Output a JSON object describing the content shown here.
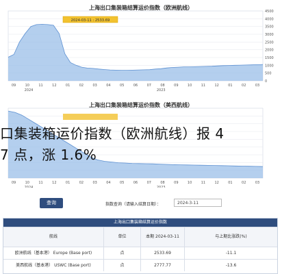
{
  "chart_data": [
    {
      "type": "area",
      "title": "上海出口集装箱结算运价指数（欧洲航线）",
      "tooltip": "2024-03-11 : 2533.69",
      "ylim": [
        0,
        4500
      ],
      "yticks": [
        "4500",
        "4000",
        "3500",
        "3000",
        "2500",
        "2000",
        "1500",
        "1000",
        "500",
        "0"
      ],
      "xticks": [
        "09",
        "10",
        "11",
        "12",
        "01",
        "02",
        "03",
        "04",
        "05",
        "06",
        "07",
        "08",
        "09",
        "10",
        "11",
        "12",
        "01",
        "02",
        "03"
      ],
      "year_labels": [
        "2024",
        "2023"
      ],
      "color": "#9bbfe8",
      "series": [
        {
          "values": [
            1520,
            1700,
            2500,
            3050,
            3500,
            3620,
            3640,
            3620,
            3580,
            3050,
            1750,
            1180,
            1000,
            880,
            820,
            800,
            760,
            730,
            700,
            690,
            680,
            680,
            690,
            700,
            710,
            720,
            760,
            780,
            830,
            860,
            880,
            900,
            900,
            910,
            920,
            930,
            940,
            960,
            980,
            990,
            1000,
            1010,
            1020,
            1030,
            1040,
            1050
          ]
        }
      ]
    },
    {
      "type": "area",
      "title": "上海出口集装箱结算运价指数（美西航线）",
      "color": "#9bbfe8",
      "series": [
        {
          "values": [
            4800,
            4700,
            4500,
            4200,
            3900,
            3600,
            3300,
            3000,
            2700,
            2400,
            2100,
            1800,
            1500,
            1300,
            1200,
            1150,
            1100,
            1080,
            1050,
            1040,
            1030,
            1020,
            1000,
            980,
            960,
            950,
            940,
            930,
            920,
            910,
            900,
            890,
            880,
            870,
            860,
            850,
            840,
            830
          ]
        }
      ]
    }
  ],
  "headline": {
    "line1": "口集装箱运价指数（欧洲航线）报 4",
    "line2": "7 点，涨 1.6%"
  },
  "query": {
    "button": "查询",
    "label": "指数查询（请输入结算日期）：",
    "date_value": "2024-3-11"
  },
  "table": {
    "title": "上海出口集装箱结算运价指数",
    "headers": [
      "航线",
      "单位",
      "本期 2024-03-11",
      "与上期比涨跌(%)"
    ],
    "rows": [
      [
        "欧洲航线（基本港） Europe (Base port)",
        "点",
        "2533.69",
        "-11.1"
      ],
      [
        "美西航线（基本港） USWC (Base port)",
        "点",
        "2777.77",
        "-13.6"
      ]
    ]
  }
}
